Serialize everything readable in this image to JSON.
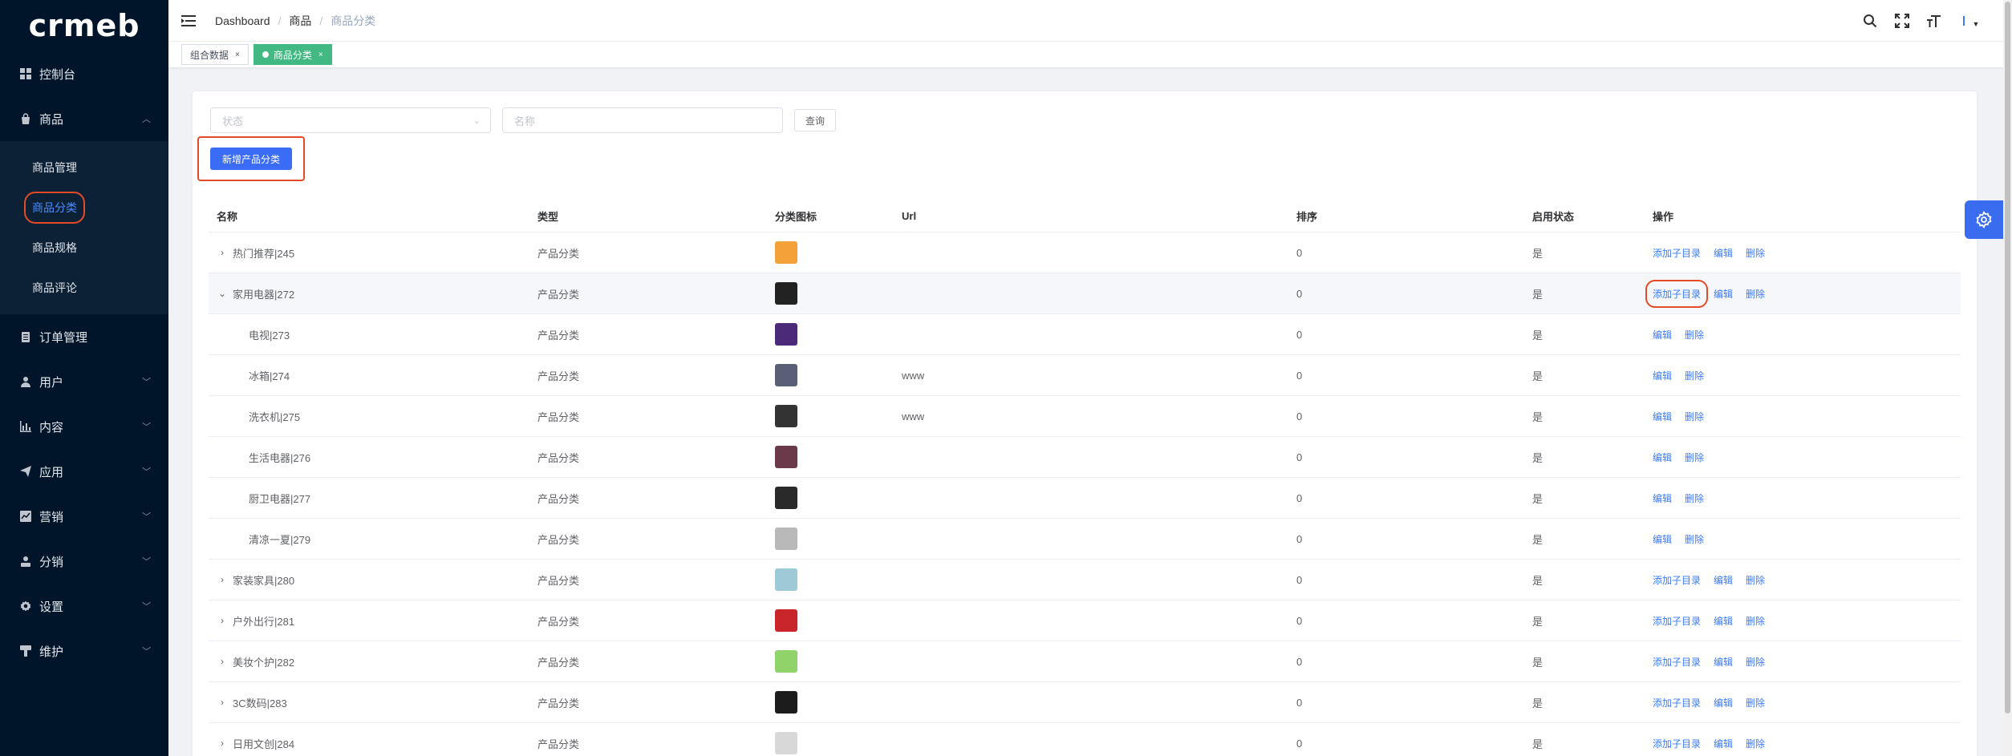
{
  "brand": "crmeb",
  "sidebar": {
    "items": [
      {
        "label": "控制台",
        "icon": "dashboard-icon"
      },
      {
        "label": "商品",
        "icon": "bag-icon",
        "expanded": true,
        "children": [
          "商品管理",
          "商品分类",
          "商品规格",
          "商品评论"
        ]
      },
      {
        "label": "订单管理",
        "icon": "clipboard-icon"
      },
      {
        "label": "用户",
        "icon": "user-icon"
      },
      {
        "label": "内容",
        "icon": "chart-icon"
      },
      {
        "label": "应用",
        "icon": "send-icon"
      },
      {
        "label": "营销",
        "icon": "marketing-icon"
      },
      {
        "label": "分销",
        "icon": "distribution-icon"
      },
      {
        "label": "设置",
        "icon": "gear-icon"
      },
      {
        "label": "维护",
        "icon": "maintenance-icon"
      }
    ],
    "active_child": "商品分类"
  },
  "header": {
    "breadcrumb": [
      "Dashboard",
      "商品",
      "商品分类"
    ]
  },
  "tags": [
    {
      "label": "组合数据",
      "active": false
    },
    {
      "label": "商品分类",
      "active": true
    }
  ],
  "filters": {
    "status_placeholder": "状态",
    "name_placeholder": "名称",
    "query_label": "查询",
    "add_label": "新增产品分类"
  },
  "table": {
    "columns": [
      "名称",
      "类型",
      "分类图标",
      "Url",
      "排序",
      "启用状态",
      "操作"
    ],
    "ops": {
      "add_child": "添加子目录",
      "edit": "编辑",
      "delete": "删除"
    },
    "rows": [
      {
        "name": "热门推荐|245",
        "type": "产品分类",
        "url": "",
        "sort": "0",
        "status": "是",
        "level": 0,
        "expand": "collapsed",
        "icon_color": "#f3a23a"
      },
      {
        "name": "家用电器|272",
        "type": "产品分类",
        "url": "",
        "sort": "0",
        "status": "是",
        "level": 0,
        "expand": "expanded",
        "icon_color": "#222222"
      },
      {
        "name": "电视|273",
        "type": "产品分类",
        "url": "",
        "sort": "0",
        "status": "是",
        "level": 1,
        "icon_color": "#4b2a7a"
      },
      {
        "name": "冰箱|274",
        "type": "产品分类",
        "url": "www",
        "sort": "0",
        "status": "是",
        "level": 1,
        "icon_color": "#5a5f78"
      },
      {
        "name": "洗衣机|275",
        "type": "产品分类",
        "url": "www",
        "sort": "0",
        "status": "是",
        "level": 1,
        "icon_color": "#333333"
      },
      {
        "name": "生活电器|276",
        "type": "产品分类",
        "url": "",
        "sort": "0",
        "status": "是",
        "level": 1,
        "icon_color": "#6b3a4a"
      },
      {
        "name": "厨卫电器|277",
        "type": "产品分类",
        "url": "",
        "sort": "0",
        "status": "是",
        "level": 1,
        "icon_color": "#2a2a2a"
      },
      {
        "name": "清凉一夏|279",
        "type": "产品分类",
        "url": "",
        "sort": "0",
        "status": "是",
        "level": 1,
        "icon_color": "#b9b9b9"
      },
      {
        "name": "家装家具|280",
        "type": "产品分类",
        "url": "",
        "sort": "0",
        "status": "是",
        "level": 0,
        "expand": "collapsed",
        "icon_color": "#9ec9d6"
      },
      {
        "name": "户外出行|281",
        "type": "产品分类",
        "url": "",
        "sort": "0",
        "status": "是",
        "level": 0,
        "expand": "collapsed",
        "icon_color": "#c8262b"
      },
      {
        "name": "美妆个护|282",
        "type": "产品分类",
        "url": "",
        "sort": "0",
        "status": "是",
        "level": 0,
        "expand": "collapsed",
        "icon_color": "#8fd36a"
      },
      {
        "name": "3C数码|283",
        "type": "产品分类",
        "url": "",
        "sort": "0",
        "status": "是",
        "level": 0,
        "expand": "collapsed",
        "icon_color": "#1c1c1c"
      },
      {
        "name": "日用文创|284",
        "type": "产品分类",
        "url": "",
        "sort": "0",
        "status": "是",
        "level": 0,
        "expand": "collapsed",
        "icon_color": "#d8d8d8"
      }
    ]
  },
  "colors": {
    "sidebar_bg": "#001529",
    "primary": "#3b6cf5",
    "tag_active": "#42b983",
    "highlight_box": "#e24b26",
    "link": "#3a7afe"
  }
}
